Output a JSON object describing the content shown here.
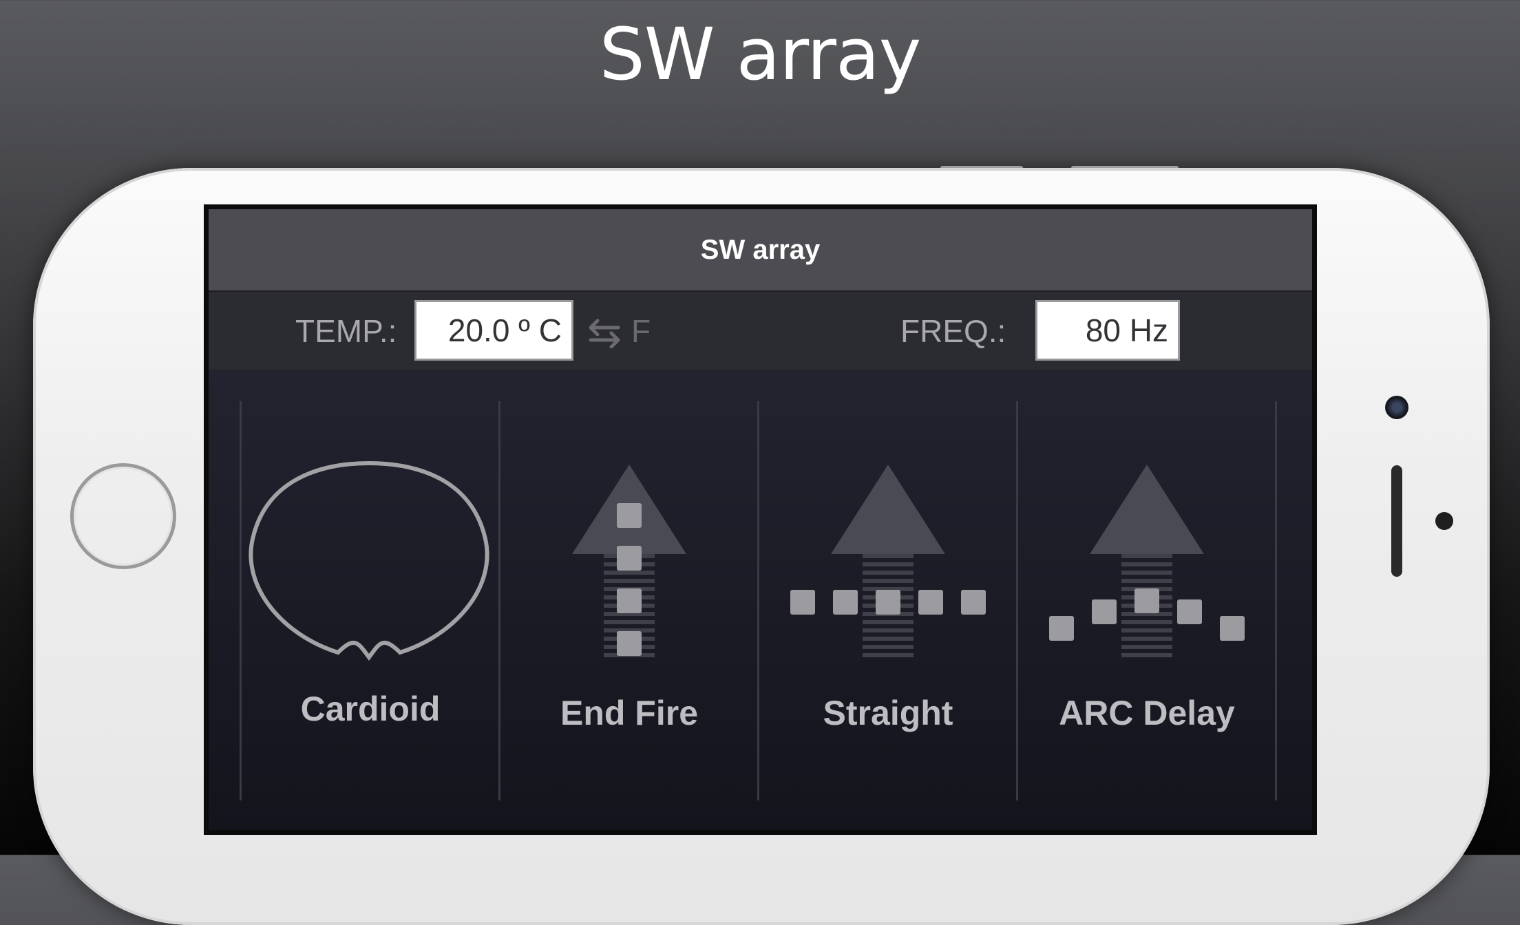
{
  "header": {
    "title": "SW array"
  },
  "app": {
    "title": "SW array",
    "settings": {
      "temp_label": "TEMP.:",
      "temp_value": "20.0 º C",
      "unit_toggle": "F",
      "freq_label": "FREQ.:",
      "freq_value": "80 Hz"
    },
    "modes": [
      {
        "label": "Cardioid",
        "icon": "cardioid-pattern-icon"
      },
      {
        "label": "End Fire",
        "icon": "end-fire-icon"
      },
      {
        "label": "Straight",
        "icon": "straight-array-icon"
      },
      {
        "label": "ARC Delay",
        "icon": "arc-delay-icon"
      }
    ]
  },
  "colors": {
    "titlebar": "#4c4c52",
    "settings_bar": "#2b2b32",
    "panel": "#1b1b25",
    "icon_gray": "#9c9ca0",
    "arrow": "#4a4a54"
  }
}
